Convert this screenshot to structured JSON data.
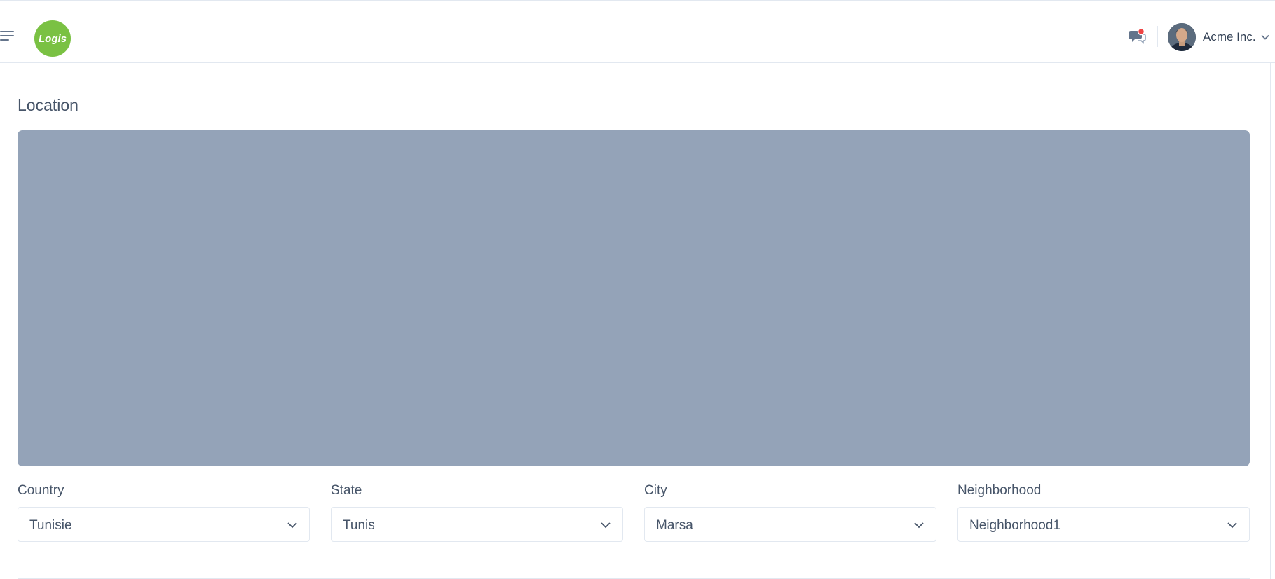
{
  "header": {
    "logo_text": "Logis",
    "user_name": "Acme Inc.",
    "menu_icon": "hamburger-icon",
    "chat_icon": "chat-notification-icon",
    "brand_color": "#7ac143",
    "notification_color": "#ef4444"
  },
  "location": {
    "title": "Location",
    "map_color": "#94a3b8",
    "fields": [
      {
        "label": "Country",
        "value": "Tunisie"
      },
      {
        "label": "State",
        "value": "Tunis"
      },
      {
        "label": "City",
        "value": "Marsa"
      },
      {
        "label": "Neighborhood",
        "value": "Neighborhood1"
      }
    ]
  }
}
